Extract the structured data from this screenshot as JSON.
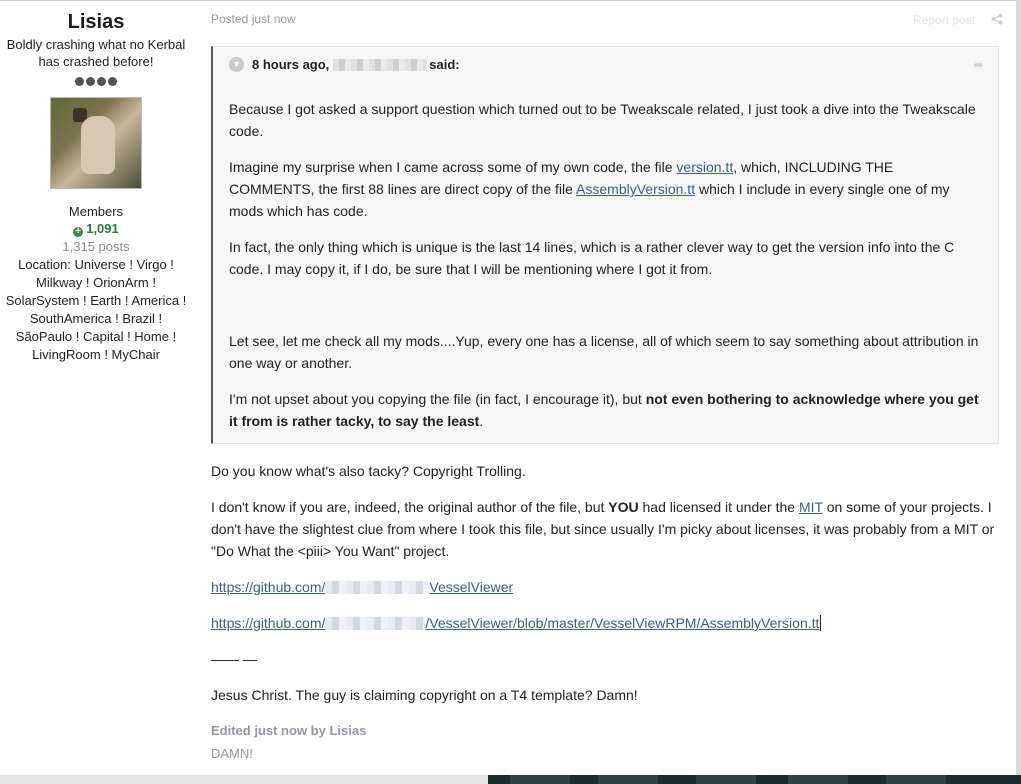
{
  "author": {
    "name": "Lisias",
    "title": "Boldly crashing what no Kerbal has crashed before!",
    "group": "Members",
    "reputation": "1,091",
    "posts": "1,315 posts",
    "location_lines": [
      "Location: Universe ! Virgo !",
      "Milkway ! OrionArm !",
      "SolarSystem ! Earth ! America !",
      "SouthAmerica ! Brazil !",
      "SãoPaulo ! Capital ! Home !",
      "LivingRoom ! MyChair"
    ]
  },
  "post": {
    "meta": "Posted just now",
    "report": "Report post",
    "quote": {
      "time": "8 hours ago,",
      "said": "said:",
      "p1": "Because I got asked a support question which turned out to be Tweakscale related, I just took a dive into the Tweakscale code.",
      "p2_a": "Imagine my surprise when I came across some of my own code, the file ",
      "p2_link1": "version.tt",
      "p2_b": ", which, INCLUDING THE COMMENTS, the first 88 lines are direct copy of the file ",
      "p2_link2": "AssemblyVersion.tt",
      "p2_c": " which I include in every single one of my mods which has code.",
      "p3": "In fact, the only thing which is unique is the last 14 lines, which is a rather clever way to get the version info into the C code.  I may copy it, if I do, be sure that I will be mentioning where I got it from.",
      "p4": "Let see, let me check all my mods....Yup, every one has a license, all of which seem to say something about attribution in one way or another.",
      "p5_a": "I'm not upset about you copying the file (in fact, I encourage it), but ",
      "p5_bold": "not even bothering to acknowledge where you get it from is rather tacky, to say the least",
      "p5_c": "."
    },
    "b1": "Do you know what's also tacky? Copyright Trolling.",
    "b2_a": "I don't know if you are, indeed, the original author of the file, but ",
    "b2_bold": "YOU",
    "b2_b": " had licensed it under the ",
    "b2_link": "MIT",
    "b2_c": " on some of your projects. I don't have the slightest clue from where I took this file, but since usually I'm picky about licenses, it was probably from a MIT or \"Do What the <piii> You Want\" project.",
    "link1_a": "https://github.com/",
    "link1_b": "VesselViewer",
    "link2_a": "https://github.com/",
    "link2_b": "/VesselViewer/blob/master/VesselViewRPM/AssemblyVersion.tt",
    "separator": "—— —",
    "b3": "Jesus Christ. The guy is claiming copyright on a T4 template? Damn!",
    "edited": "Edited just now by Lisias",
    "edit_reason": "DAMN!"
  }
}
